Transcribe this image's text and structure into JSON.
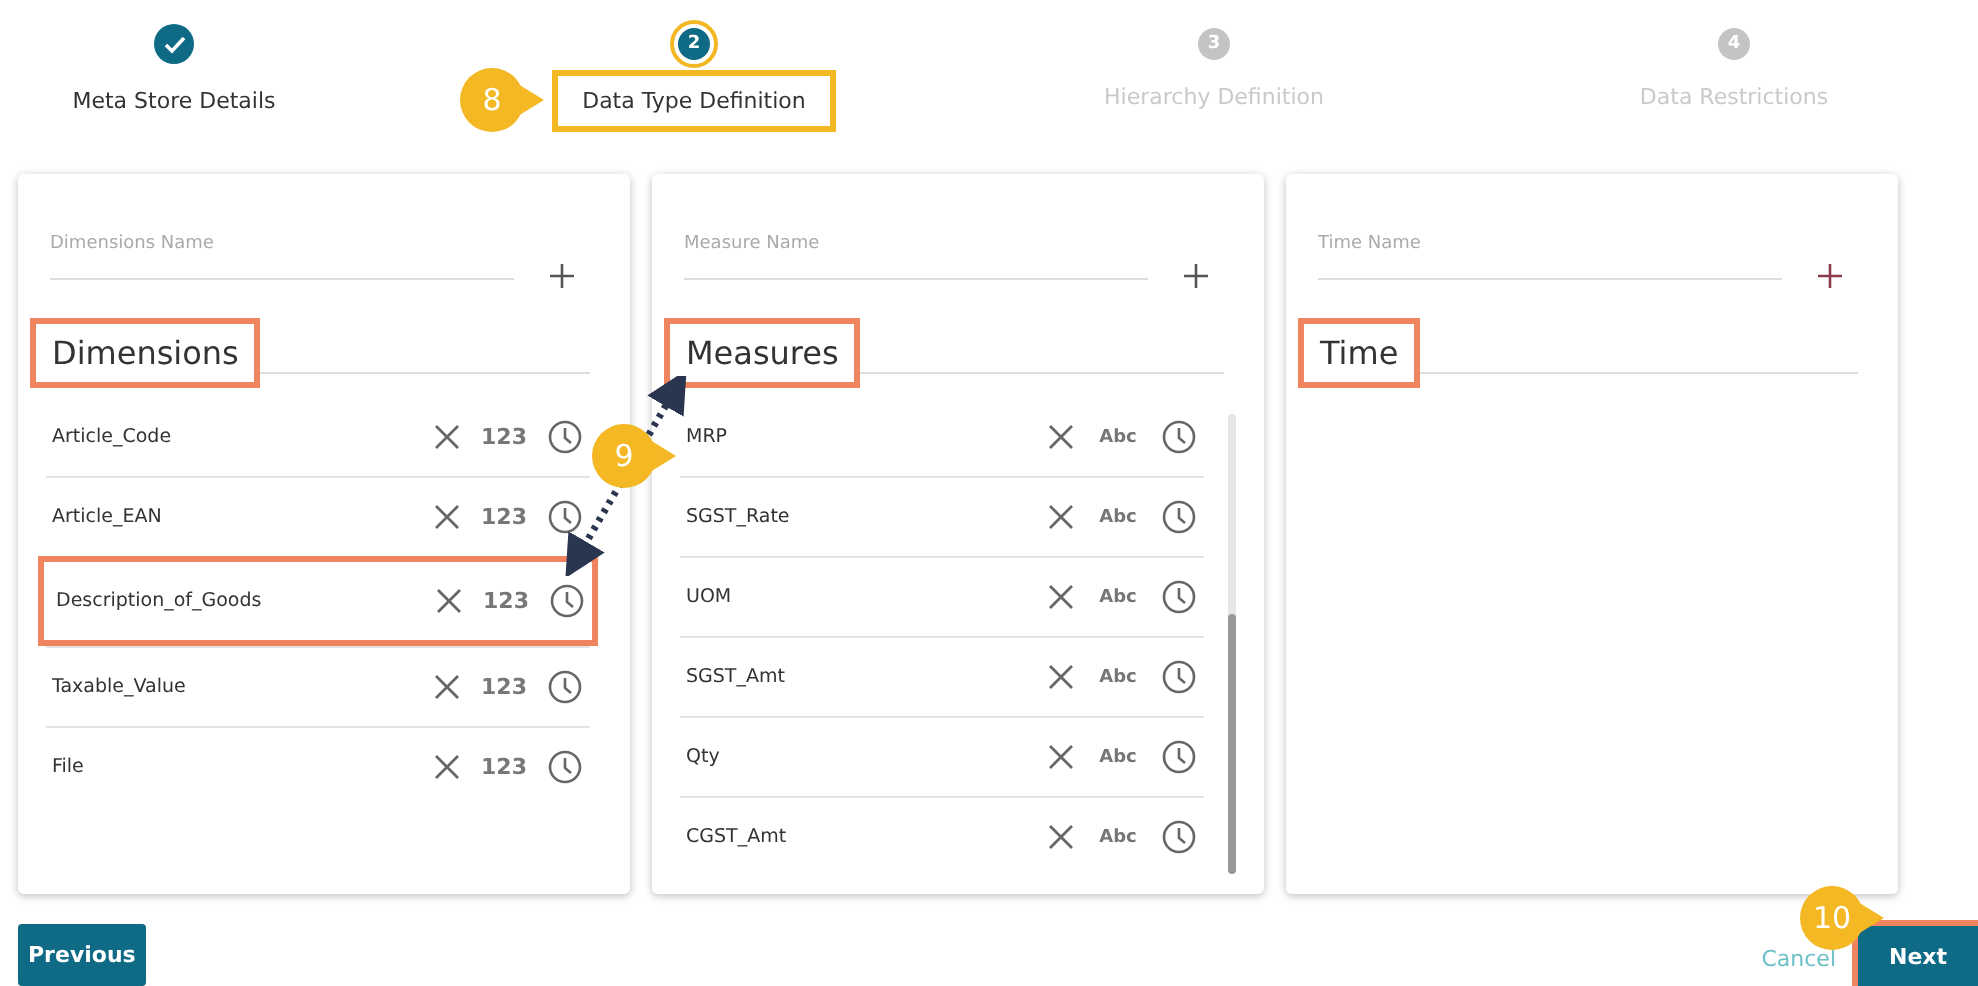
{
  "steps": [
    {
      "label": "Meta Store Details",
      "done": true,
      "selected": false,
      "highlighted": false
    },
    {
      "number": "2",
      "label": "Data Type Definition",
      "done": false,
      "selected": true,
      "highlighted": true
    },
    {
      "number": "3",
      "label": "Hierarchy Definition",
      "done": false,
      "selected": false,
      "highlighted": false
    },
    {
      "number": "4",
      "label": "Data Restrictions",
      "done": false,
      "selected": false,
      "highlighted": false
    }
  ],
  "panels": [
    {
      "placeholder": "Dimensions Name",
      "title": "Dimensions",
      "title_highlighted": true,
      "rows": [
        {
          "name": "Article_Code",
          "type": "123",
          "highlighted": false
        },
        {
          "name": "Article_EAN",
          "type": "123",
          "highlighted": false
        },
        {
          "name": "Description_of_Goods",
          "type": "123",
          "highlighted": true
        },
        {
          "name": "Taxable_Value",
          "type": "123",
          "highlighted": false
        },
        {
          "name": "File",
          "type": "123",
          "highlighted": false
        }
      ]
    },
    {
      "placeholder": "Measure Name",
      "title": "Measures",
      "title_highlighted": true,
      "rows": [
        {
          "name": "MRP",
          "type": "Abc",
          "highlighted": false
        },
        {
          "name": "SGST_Rate",
          "type": "Abc",
          "highlighted": false
        },
        {
          "name": "UOM",
          "type": "Abc",
          "highlighted": false
        },
        {
          "name": "SGST_Amt",
          "type": "Abc",
          "highlighted": false
        },
        {
          "name": "Qty",
          "type": "Abc",
          "highlighted": false
        },
        {
          "name": "CGST_Amt",
          "type": "Abc",
          "highlighted": false
        }
      ]
    },
    {
      "placeholder": "Time Name",
      "title": "Time",
      "title_highlighted": true
    }
  ],
  "footer": {
    "previous": "Previous",
    "cancel": "Cancel",
    "next": "Next",
    "next_highlighted": true
  },
  "callouts": [
    {
      "text": "8"
    },
    {
      "text": "9"
    },
    {
      "text": "10"
    }
  ]
}
